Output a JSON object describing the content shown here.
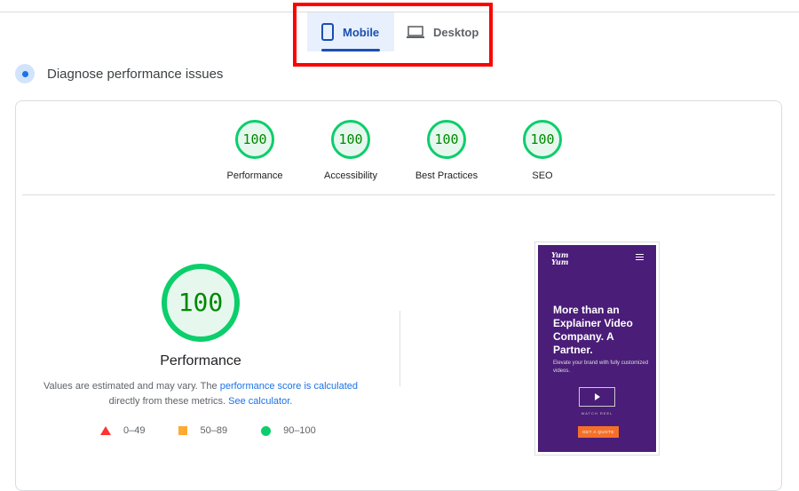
{
  "tabs": [
    {
      "label": "Mobile",
      "icon": "smartphone-icon",
      "active": true
    },
    {
      "label": "Desktop",
      "icon": "laptop-icon",
      "active": false
    }
  ],
  "section": {
    "title": "Diagnose performance issues",
    "icon": "lighthouse-icon"
  },
  "categories": [
    {
      "score": "100",
      "label": "Performance"
    },
    {
      "score": "100",
      "label": "Accessibility"
    },
    {
      "score": "100",
      "label": "Best Practices"
    },
    {
      "score": "100",
      "label": "SEO"
    }
  ],
  "main": {
    "score": "100",
    "title": "Performance",
    "note_prefix": "Values are estimated and may vary. The ",
    "note_link": "performance score is calculated",
    "note_mid": " directly from these metrics. ",
    "calc_link": "See calculator."
  },
  "legend": [
    {
      "range": "0–49",
      "color": "#ff3333"
    },
    {
      "range": "50–89",
      "color": "#ffaa33"
    },
    {
      "range": "90–100",
      "color": "#0cce6b"
    }
  ],
  "screenshot": {
    "logo": "Yum Yum",
    "headline": "More than an Explainer Video Company. A Partner.",
    "sub": "Elevate your brand with fully customized videos.",
    "watch": "WATCH REEL",
    "cta": "GET A QUOTE"
  },
  "colors": {
    "pass": "#0cce6b",
    "accent": "#1a4fb0",
    "highlight": "#ff0000"
  }
}
